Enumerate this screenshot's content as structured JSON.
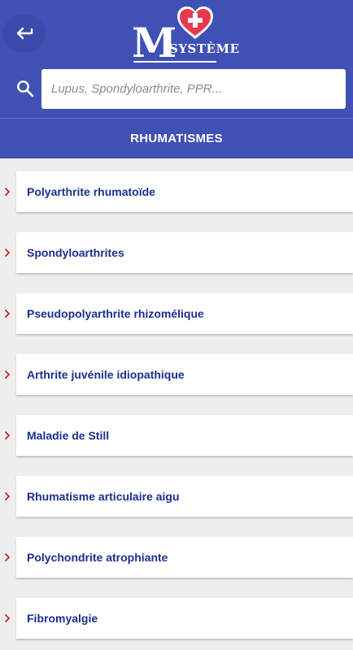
{
  "header": {
    "logo": {
      "letter": "M",
      "word": "SYSTÈME"
    }
  },
  "search": {
    "placeholder": "Lupus, Spondyloarthrite, PPR...",
    "value": ""
  },
  "section": {
    "title": "RHUMATISMES"
  },
  "items": [
    {
      "label": "Polyarthrite rhumatoïde"
    },
    {
      "label": "Spondyloarthrites"
    },
    {
      "label": "Pseudopolyarthrite rhizomélique"
    },
    {
      "label": "Arthrite juvénile idiopathique"
    },
    {
      "label": "Maladie de Still"
    },
    {
      "label": "Rhumatisme articulaire aigu"
    },
    {
      "label": "Polychondrite atrophiante"
    },
    {
      "label": "Fibromyalgie"
    }
  ],
  "colors": {
    "primary": "#3f51b5",
    "item_text": "#1a2f8f",
    "chevron": "#c62828",
    "heart": "#e53950",
    "background": "#eeeeee"
  },
  "icons": {
    "back": "arrow-back-icon",
    "search": "search-icon",
    "logo_mark": "heart-cross-icon",
    "item": "chevron-right-icon"
  }
}
